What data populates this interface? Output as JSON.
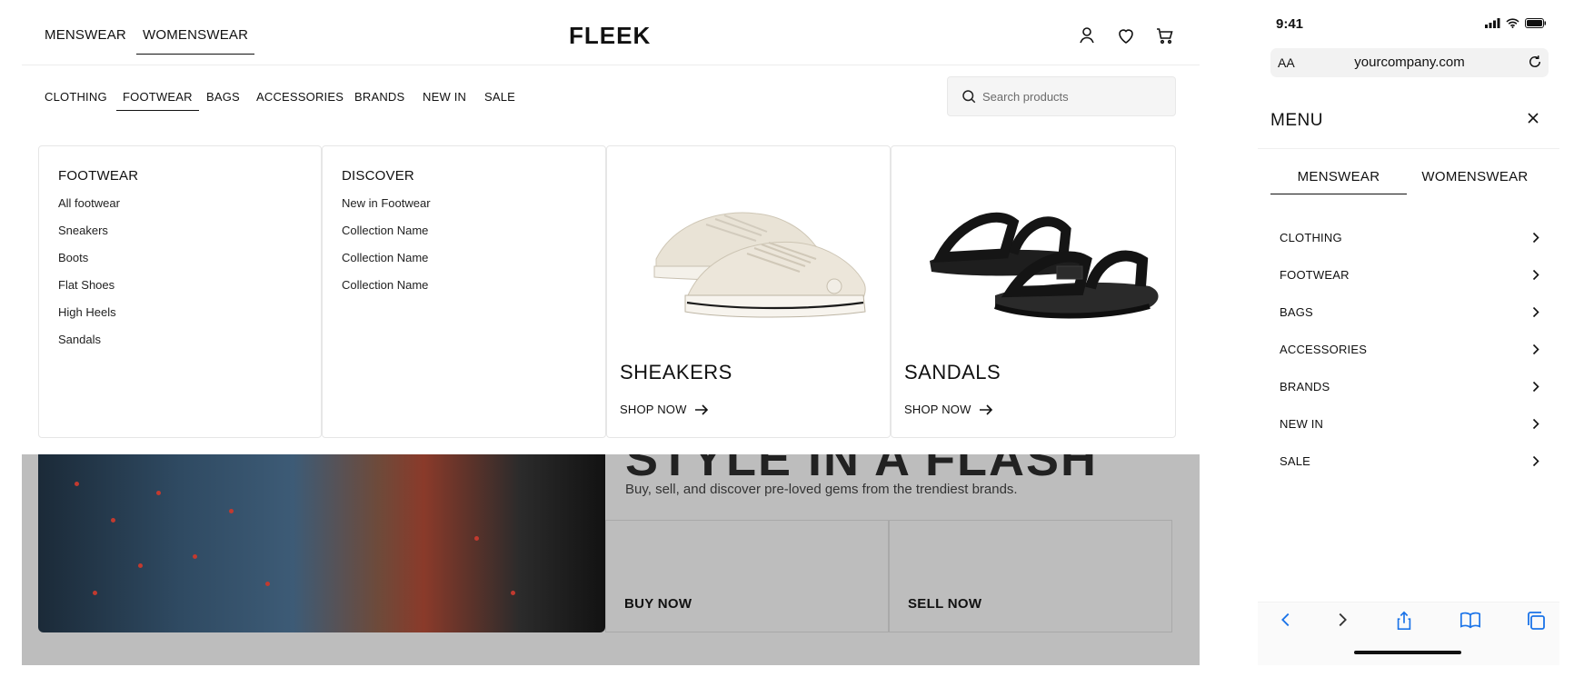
{
  "desktop": {
    "gender_tabs": [
      {
        "label": "MENSWEAR",
        "active": false
      },
      {
        "label": "WOMENSWEAR",
        "active": true
      }
    ],
    "logo": "FLEEK",
    "icons": [
      "account-icon",
      "heart-icon",
      "cart-icon"
    ],
    "categories": [
      {
        "label": "CLOTHING",
        "active": false
      },
      {
        "label": "FOOTWEAR",
        "active": true
      },
      {
        "label": "BAGS",
        "active": false
      },
      {
        "label": "ACCESSORIES",
        "active": false
      },
      {
        "label": "BRANDS",
        "active": false
      },
      {
        "label": "NEW IN",
        "active": false
      },
      {
        "label": "SALE",
        "active": false
      }
    ],
    "search": {
      "placeholder": "Search products",
      "value": ""
    },
    "mega_menu": {
      "footwear": {
        "heading": "FOOTWEAR",
        "links": [
          "All footwear",
          "Sneakers",
          "Boots",
          "Flat Shoes",
          "High Heels",
          "Sandals"
        ]
      },
      "discover": {
        "heading": "DISCOVER",
        "links": [
          "New in Footwear",
          "Collection Name",
          "Collection Name",
          "Collection Name"
        ]
      },
      "promos": [
        {
          "title": "SHEAKERS",
          "link": "SHOP NOW",
          "image": "sneaker-pair"
        },
        {
          "title": "SANDALS",
          "link": "SHOP NOW",
          "image": "sandal-pair"
        }
      ]
    },
    "hero": {
      "headline_partial": "STYLE IN A FLASH",
      "subtitle": "Buy, sell, and discover pre-loved gems from the trendiest brands.",
      "buy_label": "BUY NOW",
      "sell_label": "SELL NOW"
    }
  },
  "mobile": {
    "status_time": "9:41",
    "url": "yourcompany.com",
    "url_aa": "AA",
    "menu_title": "MENU",
    "tabs": [
      {
        "label": "MENSWEAR",
        "active": true
      },
      {
        "label": "WOMENSWEAR",
        "active": false
      }
    ],
    "items": [
      "CLOTHING",
      "FOOTWEAR",
      "BAGS",
      "ACCESSORIES",
      "BRANDS",
      "NEW IN",
      "SALE"
    ],
    "toolbar_icons": [
      "back-icon",
      "forward-icon",
      "share-icon",
      "bookmarks-icon",
      "tabs-icon"
    ]
  },
  "colors": {
    "accent": "#111111",
    "link_blue": "#1a73e8",
    "overlay_gray": "#bdbdbd"
  }
}
